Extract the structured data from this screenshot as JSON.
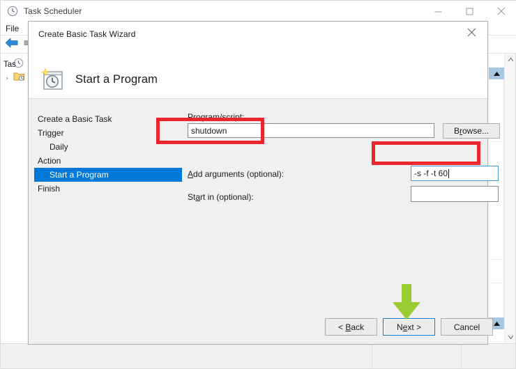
{
  "background_window": {
    "title": "Task Scheduler",
    "title_icon": "clock-icon",
    "window_controls": [
      {
        "name": "minimize",
        "glyph": "minimize-icon"
      },
      {
        "name": "maximize",
        "glyph": "maximize-icon"
      },
      {
        "name": "close",
        "glyph": "close-icon"
      }
    ],
    "menu": [
      {
        "label": "File"
      }
    ],
    "toolbar": [
      {
        "name": "back-arrow-icon"
      },
      {
        "name": "forward-arrow-icon"
      }
    ],
    "tree": [
      {
        "label": "Tas",
        "icon": "clock-icon",
        "expander": ""
      },
      {
        "label": "",
        "icon": "folder-clock-icon",
        "expander": "›"
      }
    ],
    "dots": "···"
  },
  "dialog": {
    "title": "Create Basic Task Wizard",
    "close_icon": "close-icon",
    "header": {
      "icon": "task-clock-star-icon",
      "heading": "Start a Program"
    },
    "nav": [
      {
        "label": "Create a Basic Task",
        "selected": false,
        "indent": false
      },
      {
        "label": "Trigger",
        "selected": false,
        "indent": false
      },
      {
        "label": "Daily",
        "selected": false,
        "indent": true
      },
      {
        "label": "Action",
        "selected": false,
        "indent": false
      },
      {
        "label": "Start a Program",
        "selected": true,
        "indent": true
      },
      {
        "label": "Finish",
        "selected": false,
        "indent": false
      }
    ],
    "form": {
      "program_label_pre": "P",
      "program_label_accel": "r",
      "program_label_post": "ogram/script:",
      "program_label": "Program/script:",
      "program_value": "shutdown",
      "program_placeholder": "",
      "browse_label_pre": "B",
      "browse_label_accel": "r",
      "browse_label_post": "owse...",
      "browse_label": "Browse...",
      "arguments_label_accel": "A",
      "arguments_label_post": "dd arguments (optional):",
      "arguments_label": "Add arguments (optional):",
      "arguments_value": "-s -f -t 60",
      "arguments_placeholder": "",
      "startin_label_pre": "St",
      "startin_label_accel": "a",
      "startin_label_post": "rt in (optional):",
      "startin_label": "Start in (optional):",
      "startin_value": "",
      "startin_placeholder": ""
    },
    "footer": {
      "back_label_pre": "< ",
      "back_label_accel": "B",
      "back_label_post": "ack",
      "back_label": "< Back",
      "next_label_pre": "N",
      "next_label_accel": "e",
      "next_label_post": "xt >",
      "next_label": "Next >",
      "cancel_label": "Cancel"
    }
  },
  "annotations": {
    "highlight_color": "#e8262b",
    "arrow_color": "#9acd32",
    "boxes": [
      {
        "name": "program-field-highlight"
      },
      {
        "name": "arguments-field-highlight"
      }
    ],
    "arrow": {
      "name": "next-button-arrow",
      "direction": "down"
    }
  }
}
